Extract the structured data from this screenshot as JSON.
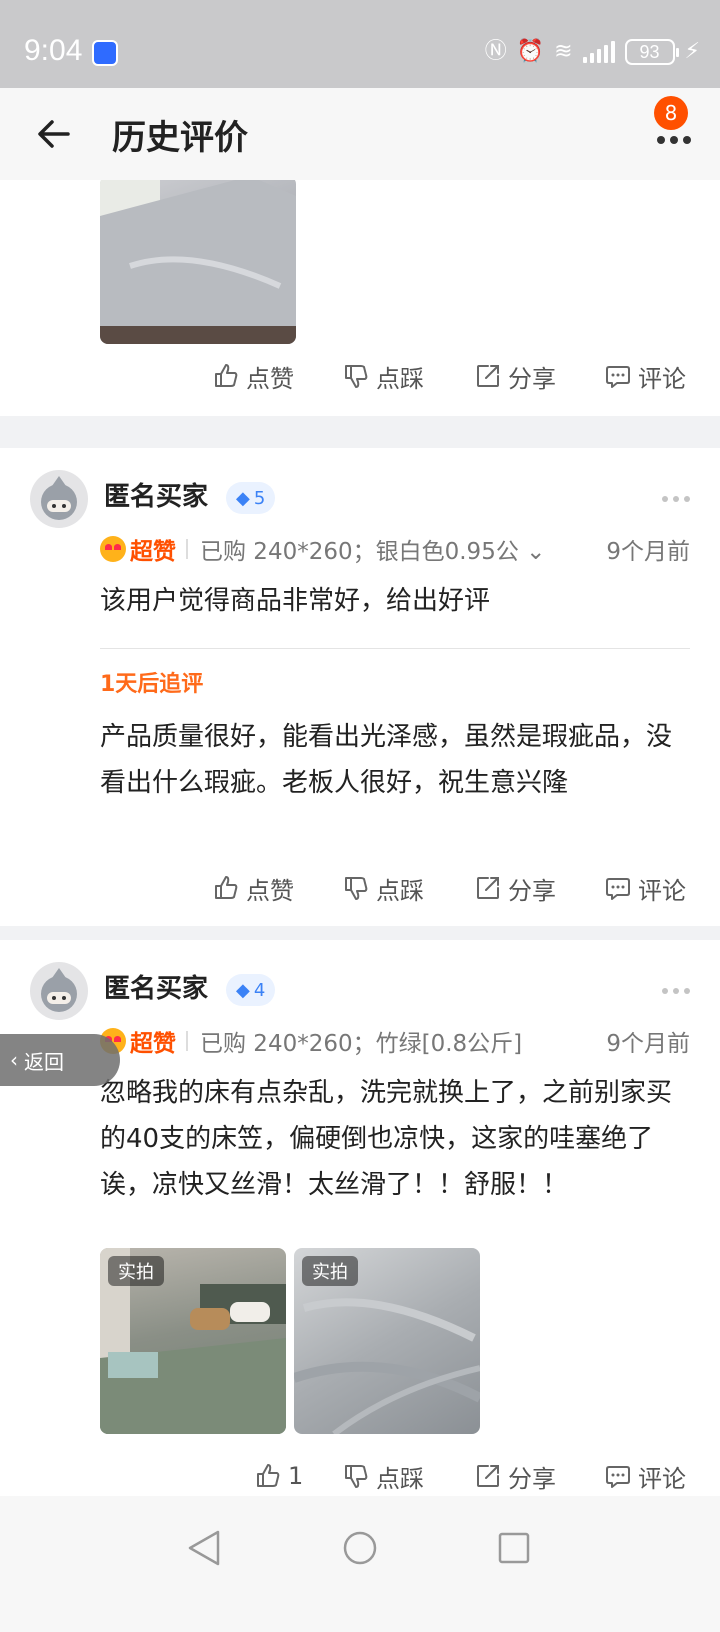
{
  "status_bar": {
    "time": "9:04",
    "battery": "93"
  },
  "header": {
    "title": "历史评价",
    "badge_count": "8"
  },
  "actions_labels": {
    "like": "点赞",
    "dislike": "点踩",
    "share": "分享",
    "comment": "评论"
  },
  "review1": {
    "username": "匿名买家",
    "level": "5",
    "rating": "超赞",
    "purchase": "已购 240*260；银白色0.95公",
    "time": "9个月前",
    "text": "该用户觉得商品非常好，给出好评",
    "followup_label": "1天后追评",
    "followup_text": "产品质量很好，能看出光泽感，虽然是瑕疵品，没看出什么瑕疵。老板人很好，祝生意兴隆"
  },
  "review2": {
    "username": "匿名买家",
    "level": "4",
    "rating": "超赞",
    "purchase": "已购 240*260；竹绿[0.8公斤]",
    "time": "9个月前",
    "text": "忽略我的床有点杂乱，洗完就换上了，之前别家买的40支的床笠，偏硬倒也凉快，这家的哇塞绝了诶，凉快又丝滑！太丝滑了！！舒服！！",
    "photo_tag": "实拍",
    "like_count": "1"
  },
  "float_back": {
    "label": "返回"
  }
}
